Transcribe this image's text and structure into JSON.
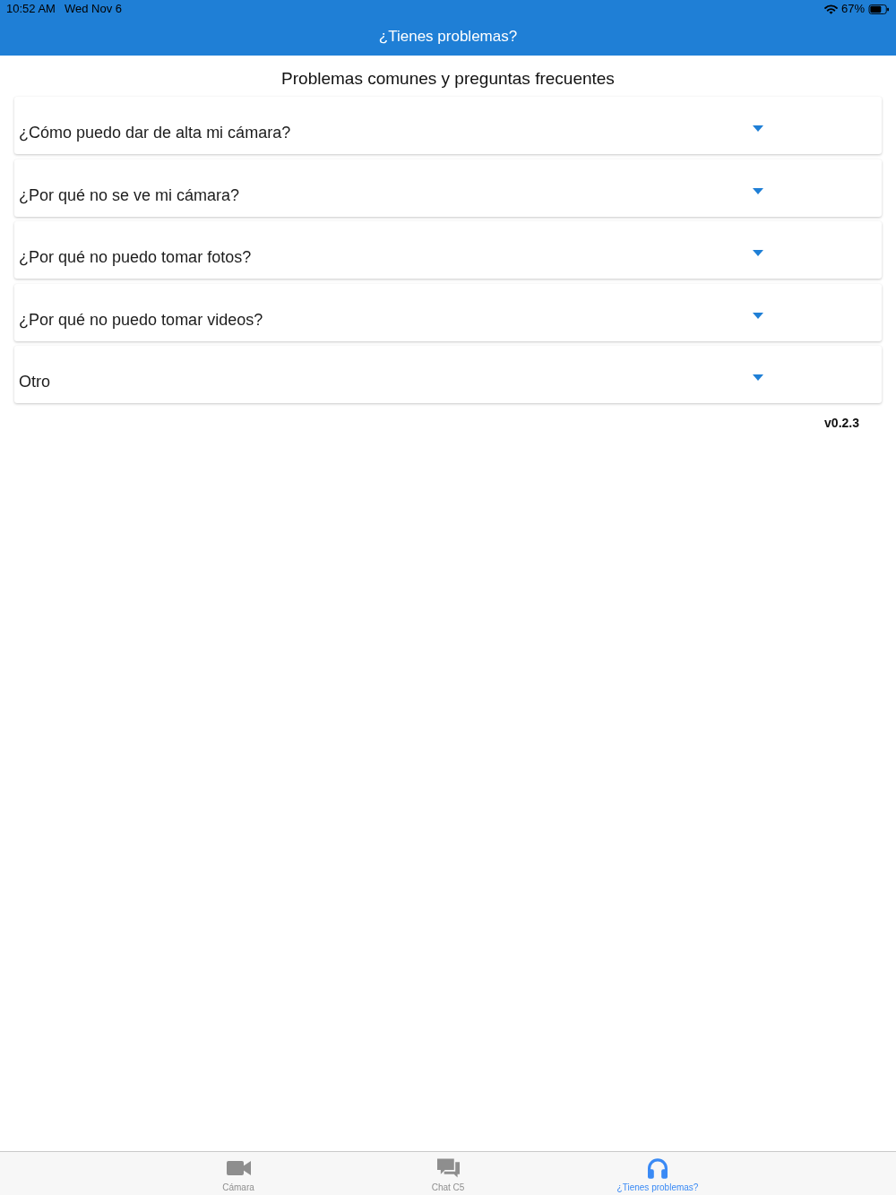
{
  "status_bar": {
    "time": "10:52 AM",
    "date": "Wed Nov 6",
    "battery": "67%"
  },
  "header": {
    "title": "¿Tienes problemas?"
  },
  "section_title": "Problemas comunes y preguntas frecuentes",
  "faq": [
    {
      "question": "¿Cómo puedo dar de alta mi cámara?",
      "expanded": false
    },
    {
      "question": "¿Por qué no se ve mi cámara?",
      "expanded": false
    },
    {
      "question": "¿Por qué no puedo tomar fotos?",
      "expanded": false
    },
    {
      "question": "¿Por qué no puedo tomar videos?",
      "expanded": false
    },
    {
      "question": "Otro",
      "expanded": false
    }
  ],
  "version": "v0.2.3",
  "tab_bar": [
    {
      "label": "Cámara",
      "kind": "camera",
      "selected": false
    },
    {
      "label": "Chat C5",
      "kind": "chat",
      "selected": false
    },
    {
      "label": "¿Tienes problemas?",
      "kind": "headphones",
      "selected": true
    }
  ]
}
